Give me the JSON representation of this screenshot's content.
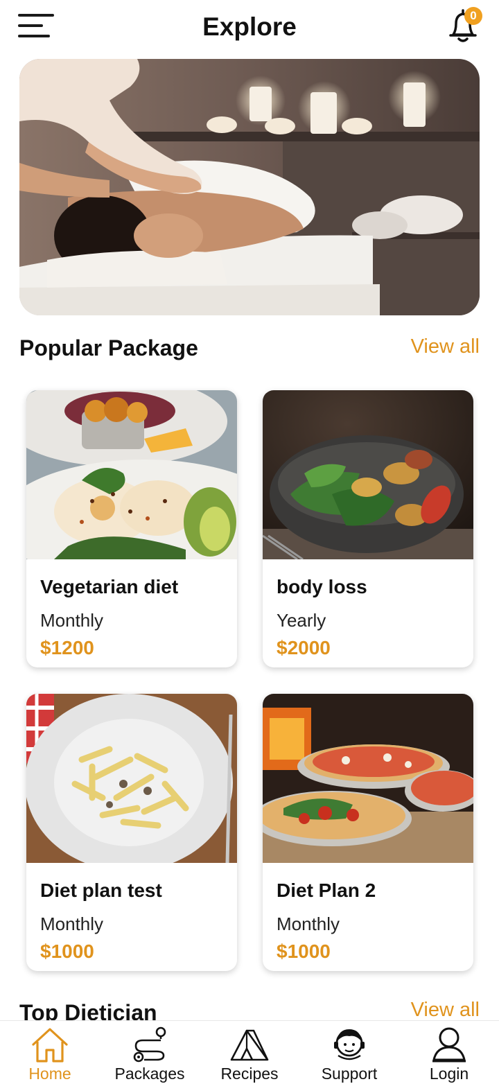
{
  "header": {
    "title": "Explore",
    "notification_count": "0",
    "menu_icon": "hamburger-menu-icon",
    "bell_icon": "bell-icon"
  },
  "hero": {
    "image": "spa-massage-banner"
  },
  "popular": {
    "title": "Popular Package",
    "view_all": "View all",
    "packages": [
      {
        "name": "Vegetarian diet",
        "period": "Monthly",
        "price": "$1200",
        "image": "poached-eggs-salad"
      },
      {
        "name": "body loss",
        "period": "Yearly",
        "price": "$2000",
        "image": "salad-bowl"
      },
      {
        "name": "Diet plan test",
        "period": "Monthly",
        "price": "$1000",
        "image": "penne-pasta"
      },
      {
        "name": "Diet Plan 2",
        "period": "Monthly",
        "price": "$1000",
        "image": "pizzas"
      }
    ]
  },
  "dietician": {
    "title": "Top Dietician",
    "view_all": "View all"
  },
  "bottom_nav": {
    "items": [
      {
        "label": "Home",
        "icon": "home-icon",
        "active": true
      },
      {
        "label": "Packages",
        "icon": "route-icon",
        "active": false
      },
      {
        "label": "Recipes",
        "icon": "tent-icon",
        "active": false
      },
      {
        "label": "Support",
        "icon": "support-agent-icon",
        "active": false
      },
      {
        "label": "Login",
        "icon": "user-icon",
        "active": false
      }
    ]
  },
  "colors": {
    "accent": "#e0931d",
    "badge": "#f0a020",
    "text": "#111111"
  }
}
